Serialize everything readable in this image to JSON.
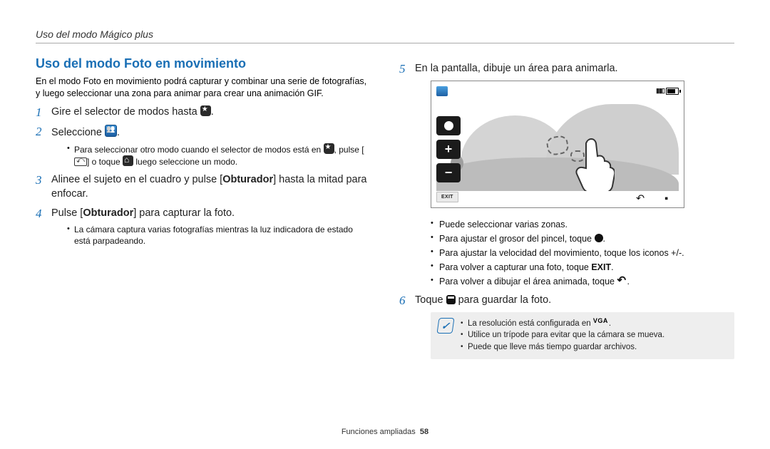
{
  "header": {
    "breadcrumb": "Uso del modo Mágico plus"
  },
  "section_title": "Uso del modo Foto en movimiento",
  "intro": "En el modo Foto en movimiento podrá capturar y combinar una serie de fotografías, y luego seleccionar una zona para animar para crear una animación GIF.",
  "left": {
    "step1": {
      "text": "Gire el selector de modos hasta "
    },
    "step2": {
      "text": "Seleccione "
    },
    "step2_sub": {
      "a_pre": "Para seleccionar otro modo cuando el selector de modos está en ",
      "a_mid": ", pulse [",
      "a_mid2": "] o toque ",
      "a_post": " luego seleccione un modo."
    },
    "step3": {
      "pre": "Alinee el sujeto en el cuadro y pulse [",
      "bold": "Obturador",
      "post": "] hasta la mitad para enfocar."
    },
    "step4": {
      "pre": "Pulse [",
      "bold": "Obturador",
      "post": "] para capturar la foto."
    },
    "step4_sub": {
      "a": "La cámara captura varias fotografías mientras la luz indicadora de estado está parpadeando."
    }
  },
  "right": {
    "step5": {
      "text": "En la pantalla, dibuje un área para animarla."
    },
    "shot": {
      "exit": "EXIT"
    },
    "step5_sub": {
      "a": "Puede seleccionar varias zonas.",
      "b_pre": "Para ajustar el grosor del pincel, toque ",
      "c": "Para ajustar la velocidad del movimiento, toque los iconos +/-.",
      "d_pre": "Para volver a capturar una foto, toque ",
      "d_bold": "EXIT",
      "e_pre": "Para volver a dibujar el área animada, toque "
    },
    "step6": {
      "pre": "Toque ",
      "post": " para guardar la foto."
    },
    "note": {
      "a_pre": "La resolución está configurada en ",
      "b": "Utilice un trípode para evitar que la cámara se mueva.",
      "c": "Puede que lleve más tiempo guardar archivos."
    }
  },
  "footer": {
    "label": "Funciones ampliadas",
    "page": "58"
  }
}
